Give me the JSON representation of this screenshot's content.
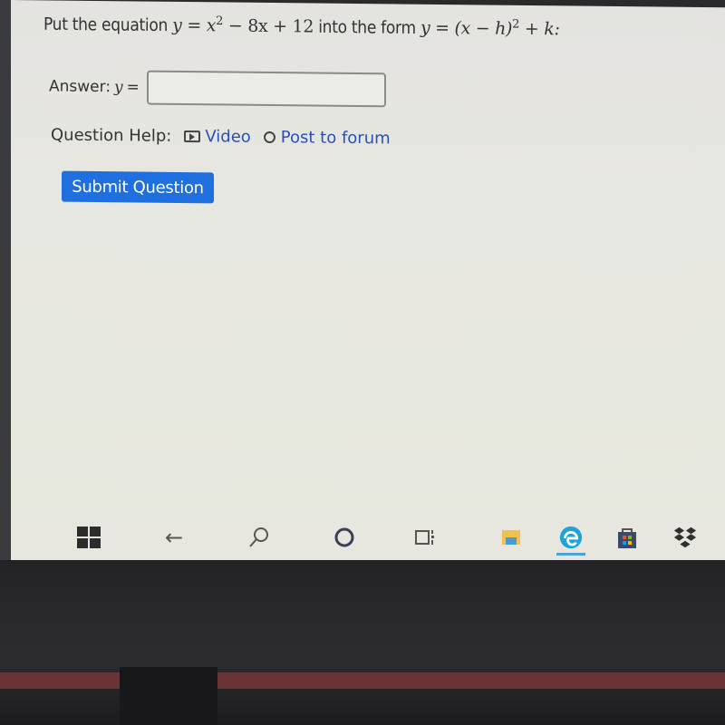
{
  "question": {
    "prefix": "Put the equation ",
    "equation": {
      "y": "y",
      "eq": " = ",
      "x": "x",
      "exp": "2",
      "rest": " − 8x + 12"
    },
    "middle": " into the form ",
    "form": {
      "lhs": "y = (x − h)",
      "exp": "2",
      "rhs": " + k:"
    }
  },
  "answer": {
    "label": "Answer: ",
    "var": "y",
    "eq": " =",
    "value": "",
    "placeholder": ""
  },
  "help": {
    "label": "Question Help:",
    "video": "Video",
    "forum": "Post to forum"
  },
  "submit": {
    "label": "Submit Question"
  },
  "taskbar": {
    "icons": [
      "windows-start-icon",
      "back-arrow-icon",
      "search-icon",
      "cortana-icon",
      "task-view-icon",
      "file-explorer-icon",
      "edge-icon",
      "microsoft-store-icon",
      "dropbox-icon"
    ],
    "back": "←",
    "search": "⚲",
    "cortana": "○"
  }
}
